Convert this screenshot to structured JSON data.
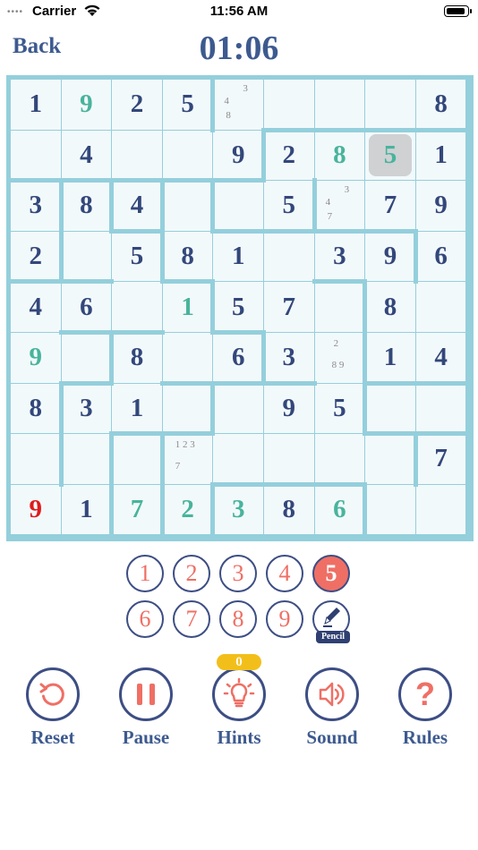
{
  "status_bar": {
    "carrier": "Carrier",
    "time": "11:56 AM",
    "battery_level": 0.95
  },
  "header": {
    "back_label": "Back",
    "timer": "01:06"
  },
  "grid": [
    [
      "1",
      "9",
      "2",
      "5",
      "",
      "",
      "",
      "",
      "8"
    ],
    [
      "",
      "4",
      "",
      "",
      "9",
      "2",
      "8",
      "5",
      "1"
    ],
    [
      "3",
      "8",
      "4",
      "",
      "",
      "5",
      "",
      "7",
      "9"
    ],
    [
      "2",
      "",
      "5",
      "8",
      "1",
      "",
      "3",
      "9",
      "6"
    ],
    [
      "4",
      "6",
      "",
      "1",
      "5",
      "7",
      "",
      "8",
      ""
    ],
    [
      "9",
      "",
      "8",
      "",
      "6",
      "3",
      "",
      "1",
      "4"
    ],
    [
      "8",
      "3",
      "1",
      "",
      "",
      "9",
      "5",
      "",
      ""
    ],
    [
      "",
      "",
      "",
      "",
      "",
      "",
      "",
      "",
      "7"
    ],
    [
      "9",
      "1",
      "7",
      "2",
      "3",
      "8",
      "6",
      "",
      ""
    ]
  ],
  "cell_states": [
    [
      "g",
      "p",
      "g",
      "g",
      "",
      "",
      "",
      "",
      "g"
    ],
    [
      "",
      "g",
      "",
      "",
      "g",
      "g",
      "p",
      "p",
      "g"
    ],
    [
      "g",
      "g",
      "g",
      "",
      "",
      "g",
      "",
      "g",
      "g"
    ],
    [
      "g",
      "",
      "g",
      "g",
      "g",
      "",
      "g",
      "g",
      "g"
    ],
    [
      "g",
      "g",
      "",
      "p",
      "g",
      "g",
      "",
      "g",
      ""
    ],
    [
      "p",
      "",
      "g",
      "",
      "g",
      "g",
      "",
      "g",
      "g"
    ],
    [
      "g",
      "g",
      "g",
      "",
      "",
      "g",
      "g",
      "",
      ""
    ],
    [
      "",
      "",
      "",
      "",
      "",
      "",
      "",
      "",
      "g"
    ],
    [
      "e",
      "g",
      "p",
      "p",
      "p",
      "g",
      "p",
      "",
      ""
    ]
  ],
  "notes": [
    {
      "row": 0,
      "col": 4,
      "lines": [
        "3",
        "4",
        "8"
      ]
    },
    {
      "row": 2,
      "col": 6,
      "lines": [
        "3",
        "4",
        "7"
      ]
    },
    {
      "row": 5,
      "col": 6,
      "lines": [
        "2",
        "8 9"
      ]
    },
    {
      "row": 7,
      "col": 3,
      "lines": [
        "1 2 3",
        "7"
      ]
    }
  ],
  "selected": {
    "row": 1,
    "col": 7
  },
  "number_pad": {
    "numbers": [
      "1",
      "2",
      "3",
      "4",
      "5",
      "6",
      "7",
      "8",
      "9"
    ],
    "active": "5",
    "pencil_label": "Pencil"
  },
  "controls": {
    "reset_label": "Reset",
    "pause_label": "Pause",
    "hints_label": "Hints",
    "sound_label": "Sound",
    "rules_label": "Rules",
    "hints_count": "0",
    "rules_symbol": "?"
  },
  "colors": {
    "given": "#33477a",
    "placed": "#48b49c",
    "error": "#e01a1a",
    "accent": "#ef6f65",
    "frame": "#94cfdc",
    "cell": "#f2f9fb",
    "badge": "#f2bf1a",
    "navy": "#3d4e84"
  },
  "icons": {
    "reset": "reset-arrow-icon",
    "pause": "pause-icon",
    "hints": "lightbulb-icon",
    "sound": "speaker-icon",
    "rules": "question-mark-icon",
    "pencil": "pencil-icon"
  }
}
